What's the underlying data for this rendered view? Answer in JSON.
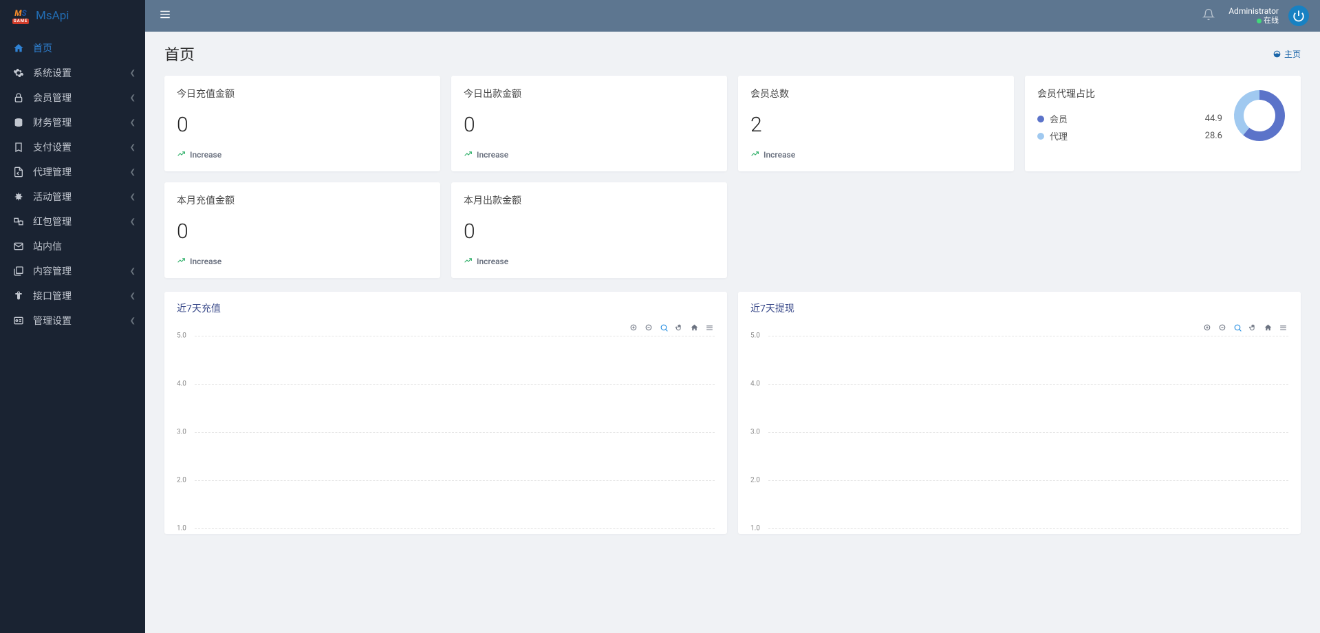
{
  "brand": {
    "name": "MsApi"
  },
  "header": {
    "username": "Administrator",
    "status_label": "在线"
  },
  "page": {
    "title": "首页",
    "breadcrumb": "主页"
  },
  "sidebar": [
    {
      "id": "home",
      "label": "首页",
      "active": true,
      "expandable": false
    },
    {
      "id": "system",
      "label": "系统设置",
      "active": false,
      "expandable": true
    },
    {
      "id": "member",
      "label": "会员管理",
      "active": false,
      "expandable": true
    },
    {
      "id": "finance",
      "label": "财务管理",
      "active": false,
      "expandable": true
    },
    {
      "id": "payment",
      "label": "支付设置",
      "active": false,
      "expandable": true
    },
    {
      "id": "agent",
      "label": "代理管理",
      "active": false,
      "expandable": true
    },
    {
      "id": "activity",
      "label": "活动管理",
      "active": false,
      "expandable": true
    },
    {
      "id": "redpacket",
      "label": "红包管理",
      "active": false,
      "expandable": true
    },
    {
      "id": "inbox",
      "label": "站内信",
      "active": false,
      "expandable": false
    },
    {
      "id": "content",
      "label": "内容管理",
      "active": false,
      "expandable": true
    },
    {
      "id": "api",
      "label": "接口管理",
      "active": false,
      "expandable": true
    },
    {
      "id": "admin",
      "label": "管理设置",
      "active": false,
      "expandable": true
    }
  ],
  "stat_cards": [
    {
      "key": "today_recharge",
      "title": "今日充值金额",
      "value": "0",
      "trend": "Increase"
    },
    {
      "key": "today_withdraw",
      "title": "今日出款金额",
      "value": "0",
      "trend": "Increase"
    },
    {
      "key": "member_total",
      "title": "会员总数",
      "value": "2",
      "trend": "Increase"
    },
    {
      "key": "month_recharge",
      "title": "本月充值金额",
      "value": "0",
      "trend": "Increase"
    },
    {
      "key": "month_withdraw",
      "title": "本月出款金额",
      "value": "0",
      "trend": "Increase"
    }
  ],
  "donut": {
    "title": "会员代理占比",
    "series": [
      {
        "label": "会员",
        "value": 44.9,
        "color": "#5b73c9"
      },
      {
        "label": "代理",
        "value": 28.6,
        "color": "#a0c9f0"
      }
    ]
  },
  "charts": [
    {
      "key": "recharge7",
      "title": "近7天充值"
    },
    {
      "key": "withdraw7",
      "title": "近7天提现"
    }
  ],
  "chart_data": [
    {
      "type": "line",
      "title": "近7天充值",
      "categories": [],
      "values": [],
      "ylim": [
        1.0,
        5.0
      ],
      "yticks": [
        1.0,
        2.0,
        3.0,
        4.0,
        5.0
      ],
      "xlabel": "",
      "ylabel": ""
    },
    {
      "type": "line",
      "title": "近7天提现",
      "categories": [],
      "values": [],
      "ylim": [
        1.0,
        5.0
      ],
      "yticks": [
        1.0,
        2.0,
        3.0,
        4.0,
        5.0
      ],
      "xlabel": "",
      "ylabel": ""
    }
  ]
}
